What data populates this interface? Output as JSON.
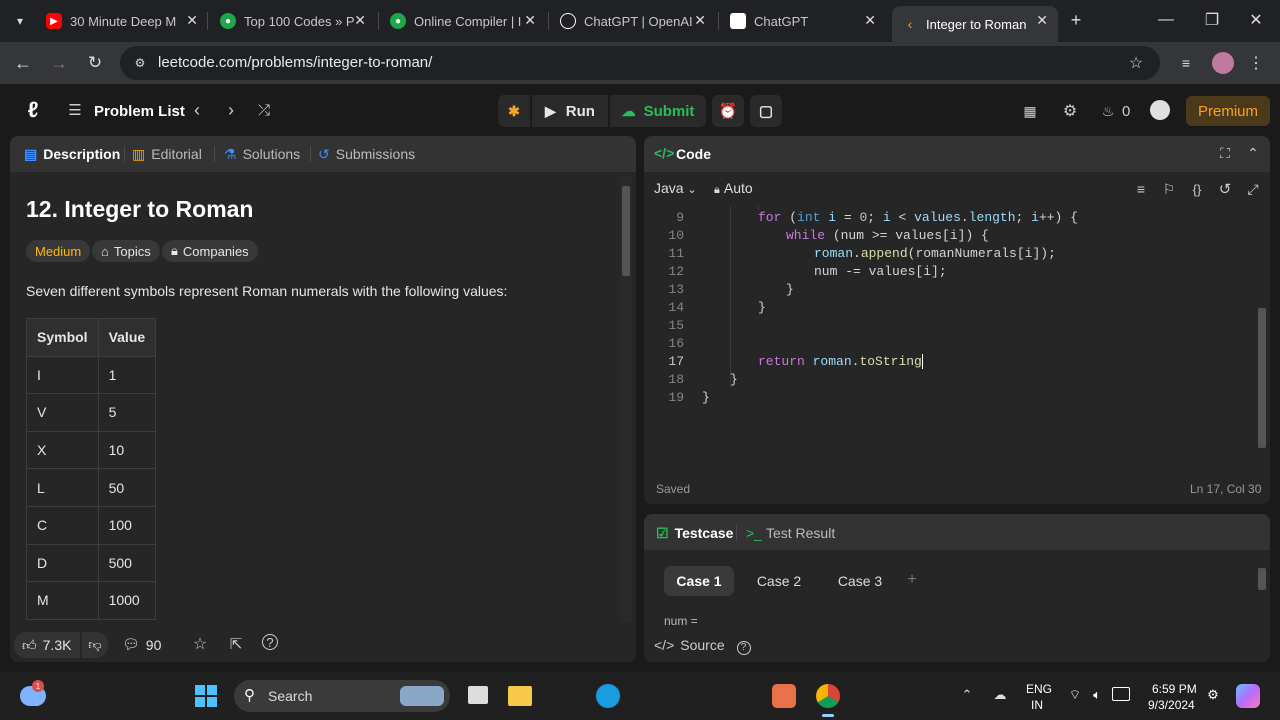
{
  "browser": {
    "tabs": [
      {
        "title": "30 Minute Deep M",
        "icon": "youtube-icon",
        "color": "#ff0000"
      },
      {
        "title": "Top 100 Codes » P",
        "icon": "green-hex-icon",
        "color": "#1ea64b"
      },
      {
        "title": "Online Compiler | I",
        "icon": "green-hex-icon",
        "color": "#1ea64b"
      },
      {
        "title": "ChatGPT | OpenAI",
        "icon": "openai-icon",
        "color": "#ffffff"
      },
      {
        "title": "ChatGPT",
        "icon": "openai-icon",
        "color": "#ffffff"
      },
      {
        "title": "Integer to Roman",
        "icon": "leetcode-icon",
        "color": "#ffa116"
      }
    ],
    "url": "leetcode.com/problems/integer-to-roman/"
  },
  "nav": {
    "problem_list": "Problem List",
    "run": "Run",
    "submit": "Submit",
    "streak_count": "0",
    "premium": "Premium"
  },
  "left": {
    "tabs": {
      "description": "Description",
      "editorial": "Editorial",
      "solutions": "Solutions",
      "submissions": "Submissions"
    },
    "title": "12. Integer to Roman",
    "difficulty": "Medium",
    "topics": "Topics",
    "companies": "Companies",
    "intro": "Seven different symbols represent Roman numerals with the following values:",
    "table": {
      "headers": [
        "Symbol",
        "Value"
      ],
      "rows": [
        [
          "I",
          "1"
        ],
        [
          "V",
          "5"
        ],
        [
          "X",
          "10"
        ],
        [
          "L",
          "50"
        ],
        [
          "C",
          "100"
        ],
        [
          "D",
          "500"
        ],
        [
          "M",
          "1000"
        ]
      ]
    },
    "footer": {
      "likes": "7.3K",
      "comments": "90"
    }
  },
  "code": {
    "title": "Code",
    "language": "Java",
    "auto": "Auto",
    "line_numbers": [
      "9",
      "10",
      "11",
      "12",
      "13",
      "14",
      "15",
      "16",
      "17",
      "18",
      "19"
    ],
    "status_saved": "Saved",
    "cursor_pos": "Ln 17, Col 30"
  },
  "testcase": {
    "tab_testcase": "Testcase",
    "tab_result": "Test Result",
    "cases": [
      "Case 1",
      "Case 2",
      "Case 3"
    ],
    "input_label": "num =",
    "source": "Source"
  },
  "taskbar": {
    "search": "Search",
    "lang_top": "ENG",
    "lang_bottom": "IN",
    "time": "6:59 PM",
    "date": "9/3/2024",
    "notif_badge": "1"
  },
  "colors": {
    "accent_green": "#2cbb5d",
    "medium": "#ffb800",
    "premium_bg": "#4a3a1a",
    "premium_fg": "#ffa116"
  }
}
